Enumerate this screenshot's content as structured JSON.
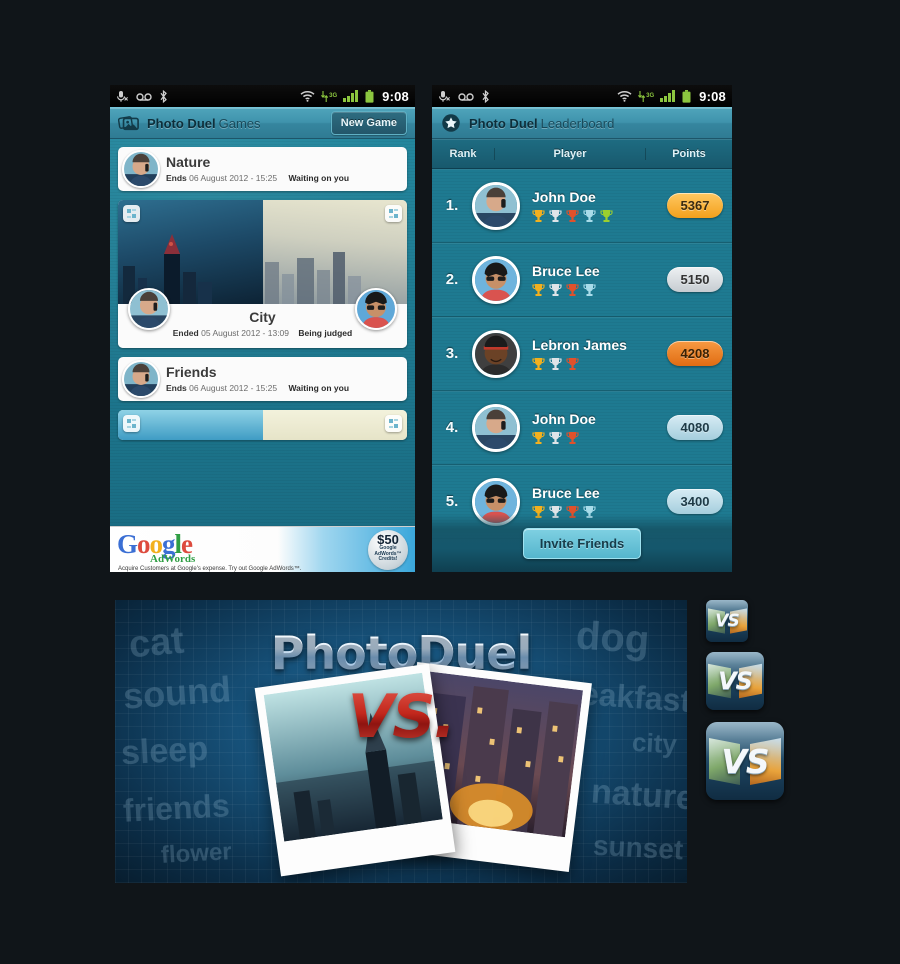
{
  "page": {
    "background_color": "#101519",
    "accent_teal": "#1e7a91",
    "title_bar_color": "#3f93ac"
  },
  "status_bar": {
    "icons": [
      "microphone-muted-icon",
      "voicemail-icon",
      "bluetooth-icon",
      "wifi-icon",
      "3g-icon",
      "signal-bars-icon",
      "battery-icon"
    ],
    "network_label": "3G",
    "clock": "9:08"
  },
  "games_screen": {
    "title_main": "Photo Duel",
    "title_sub": "Games",
    "app_icon": "photos-stack-icon",
    "new_game_label": "New Game",
    "cards": [
      {
        "type": "simple",
        "name": "Nature",
        "time_label": "Ends",
        "time_value": "06 August 2012 - 15:25",
        "status": "Waiting on you"
      },
      {
        "type": "duel",
        "name": "City",
        "time_label": "Ended",
        "time_value": "05 August 2012 - 13:09",
        "status": "Being judged",
        "left_photo": "city-skyline-blue-dusk",
        "right_photo": "city-skyline-hazy-daylight",
        "expand_icon": "expand-photo-icon"
      },
      {
        "type": "simple",
        "name": "Friends",
        "time_label": "Ends",
        "time_value": "06 August 2012 - 15:25",
        "status": "Waiting on you"
      },
      {
        "type": "duel-peek",
        "name": "",
        "time_label": "",
        "time_value": "",
        "status": "",
        "expand_icon": "expand-photo-icon"
      }
    ],
    "ad": {
      "brand": "Google",
      "brand_letters": [
        "G",
        "o",
        "o",
        "g",
        "l",
        "e"
      ],
      "product": "AdWords",
      "tagline": "Acquire Customers at Google's expense. Try out Google AdWords™.",
      "seal_amount": "$50",
      "seal_line1": "Google",
      "seal_line2": "AdWords™",
      "seal_line3": "Credits!"
    }
  },
  "leaderboard_screen": {
    "title_main": "Photo Duel",
    "title_sub": "Leaderboard",
    "app_icon": "star-badge-icon",
    "columns": [
      "Rank",
      "Player",
      "Points"
    ],
    "rows": [
      {
        "rank": "1.",
        "name": "John Doe",
        "points": "5367",
        "points_color": "#f5a623",
        "avatar": "man-phone-avatar",
        "trophies": [
          "#f2b01e",
          "#dfe4e8",
          "#e0512b",
          "#a8dcea",
          "#9ccf2e"
        ]
      },
      {
        "rank": "2.",
        "name": "Bruce Lee",
        "points": "5150",
        "points_color": "#d4d9dd",
        "avatar": "bruce-lee-avatar",
        "trophies": [
          "#f2b01e",
          "#dfe4e8",
          "#e0512b",
          "#a8dcea"
        ]
      },
      {
        "rank": "3.",
        "name": "Lebron James",
        "points": "4208",
        "points_color": "#e8721c",
        "avatar": "lebron-james-avatar",
        "trophies": [
          "#f2b01e",
          "#dfe4e8",
          "#e0512b"
        ]
      },
      {
        "rank": "4.",
        "name": "John Doe",
        "points": "4080",
        "points_color": "#b9dce8",
        "avatar": "man-phone-avatar",
        "trophies": [
          "#f2b01e",
          "#dfe4e8",
          "#e0512b"
        ]
      },
      {
        "rank": "5.",
        "name": "Bruce Lee",
        "points": "3400",
        "points_color": "#b9dce8",
        "avatar": "bruce-lee-avatar",
        "trophies": [
          "#f2b01e",
          "#dfe4e8",
          "#e0512b",
          "#a8dcea"
        ]
      }
    ],
    "invite_label": "Invite Friends"
  },
  "splash": {
    "logo_first": "Photo",
    "logo_second": "Duel",
    "vs_text": "VS.",
    "keywords": [
      "cat",
      "sound",
      "sleep",
      "friends",
      "flower",
      "dog",
      "breakfast",
      "city",
      "nature",
      "sunset"
    ],
    "left_photo": "city-skyline-teal",
    "right_photo": "city-night-lights"
  },
  "app_icons": {
    "label": "VS",
    "sizes": [
      "small",
      "medium",
      "large"
    ]
  }
}
